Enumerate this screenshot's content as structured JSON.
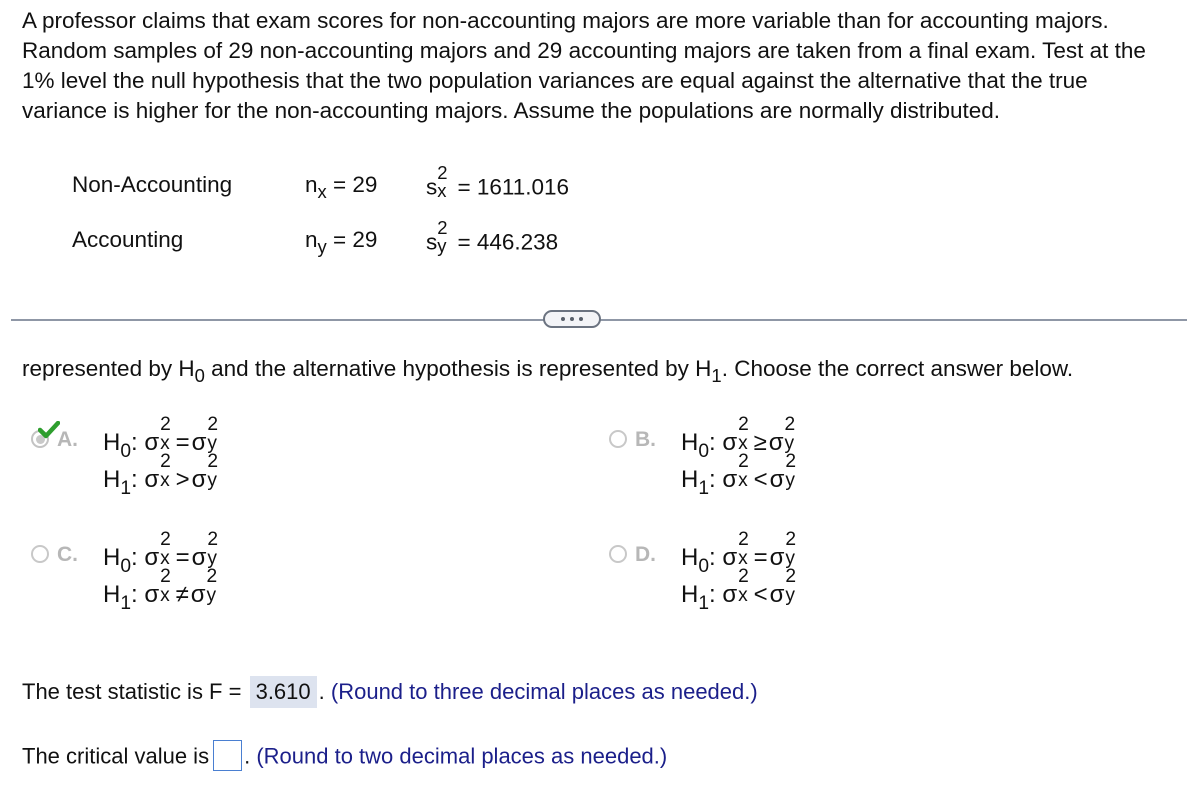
{
  "problem": {
    "text": "A professor claims that exam scores for non-accounting majors are more variable than for accounting majors. Random samples of 29 non-accounting majors and 29 accounting majors are taken from a final exam. Test at the 1% level the null hypothesis that the two population variances are equal against the alternative that the true variance is higher for the non-accounting majors. Assume the populations are normally distributed."
  },
  "samples": [
    {
      "group": "Non-Accounting",
      "n_symbol": "n",
      "n_sub": "x",
      "n_value": "= 29",
      "s_symbol": "s",
      "s_sup": "2",
      "s_sub": "x",
      "s_value": "= 1611.016"
    },
    {
      "group": "Accounting",
      "n_symbol": "n",
      "n_sub": "y",
      "n_value": "= 29",
      "s_symbol": "s",
      "s_sup": "2",
      "s_sub": "y",
      "s_value": "= 446.238"
    }
  ],
  "more_button": {
    "label": "more-options",
    "glyph": "•••"
  },
  "question": {
    "part1": "represented by H",
    "sub0": "0",
    "part2": " and the alternative hypothesis is represented by H",
    "sub1": "1",
    "part3": ". Choose the correct answer below."
  },
  "options": [
    {
      "letter": "A.",
      "selected": true,
      "correct_mark": true,
      "h0": {
        "label": "H",
        "sub": "0",
        "rel": "="
      },
      "h1": {
        "label": "H",
        "sub": "1",
        "rel": ">"
      }
    },
    {
      "letter": "B.",
      "selected": false,
      "h0": {
        "label": "H",
        "sub": "0",
        "rel": "≥"
      },
      "h1": {
        "label": "H",
        "sub": "1",
        "rel": "<"
      }
    },
    {
      "letter": "C.",
      "selected": false,
      "h0": {
        "label": "H",
        "sub": "0",
        "rel": "="
      },
      "h1": {
        "label": "H",
        "sub": "1",
        "rel": "≠"
      }
    },
    {
      "letter": "D.",
      "selected": false,
      "h0": {
        "label": "H",
        "sub": "0",
        "rel": "="
      },
      "h1": {
        "label": "H",
        "sub": "1",
        "rel": "<"
      }
    }
  ],
  "sigma": {
    "symbol": "σ",
    "sup": "2",
    "sub_x": "x",
    "sub_y": "y",
    "colon": ":"
  },
  "test_statistic": {
    "prefix": "The test statistic is F =",
    "value": "3.610",
    "period": ".",
    "hint": "(Round to three decimal places as needed.)"
  },
  "critical_value": {
    "prefix": "The critical value is",
    "value": "",
    "period": ".",
    "hint": "(Round to two decimal places as needed.)"
  },
  "colors": {
    "text": "#111111",
    "hint": "#1b1f8a",
    "answer_bg": "#dde3ef",
    "input_border": "#4a7fd1",
    "check_green": "#2e9e2e",
    "divider": "#8f97a6"
  }
}
